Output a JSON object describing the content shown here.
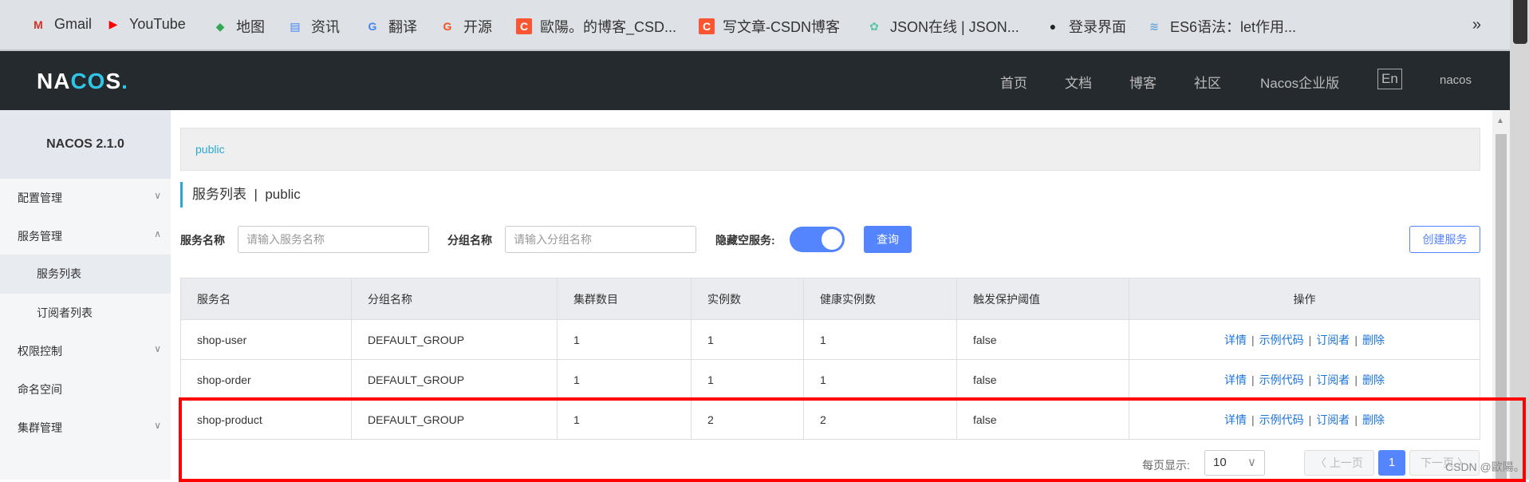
{
  "bookmarks": [
    {
      "label": "Gmail",
      "icon": "gmail-icon",
      "color": "#d93025"
    },
    {
      "label": "YouTube",
      "icon": "youtube-icon",
      "color": "#ff0000"
    },
    {
      "label": "地图",
      "icon": "maps-icon",
      "color": "#34a853"
    },
    {
      "label": "资讯",
      "icon": "news-icon",
      "color": "#4285f4"
    },
    {
      "label": "翻译",
      "icon": "translate-icon",
      "color": "#4285f4"
    },
    {
      "label": "开源",
      "icon": "g-icon",
      "color": "#f4511e"
    },
    {
      "label": "歐陽。的博客_CSD...",
      "icon": "csdn-icon",
      "color": "#fc5531"
    },
    {
      "label": "写文章-CSDN博客",
      "icon": "csdn-icon",
      "color": "#fc5531"
    },
    {
      "label": "JSON在线 | JSON...",
      "icon": "flower-icon",
      "color": "#5cc7a8"
    },
    {
      "label": "登录界面",
      "icon": "globe-icon",
      "color": "#222"
    },
    {
      "label": "ES6语法：let作用...",
      "icon": "scroll-icon",
      "color": "#6aa6d8"
    }
  ],
  "bookmarks_more": "»",
  "header": {
    "logo": "NACOS.",
    "nav": [
      "首页",
      "文档",
      "博客",
      "社区",
      "Nacos企业版"
    ],
    "lang": "En",
    "user": "nacos"
  },
  "sidebar": {
    "version": "NACOS 2.1.0",
    "items": [
      {
        "label": "配置管理",
        "chevron": "down"
      },
      {
        "label": "服务管理",
        "chevron": "up"
      },
      {
        "label": "服务列表",
        "sub": true,
        "selected": true
      },
      {
        "label": "订阅者列表",
        "sub": true
      },
      {
        "label": "权限控制",
        "chevron": "down"
      },
      {
        "label": "命名空间"
      },
      {
        "label": "集群管理",
        "chevron": "down"
      }
    ]
  },
  "breadcrumb": "public",
  "page_title": "服务列表",
  "page_title_sep": "|",
  "page_namespace": "public",
  "filters": {
    "service_name_label": "服务名称",
    "service_name_placeholder": "请输入服务名称",
    "group_name_label": "分组名称",
    "group_name_placeholder": "请输入分组名称",
    "hide_empty_label": "隐藏空服务:",
    "hide_empty_on": true,
    "query_button": "查询",
    "create_button": "创建服务"
  },
  "table": {
    "columns": [
      "服务名",
      "分组名称",
      "集群数目",
      "实例数",
      "健康实例数",
      "触发保护阈值",
      "操作"
    ],
    "rows": [
      [
        "shop-user",
        "DEFAULT_GROUP",
        "1",
        "1",
        "1",
        "false"
      ],
      [
        "shop-order",
        "DEFAULT_GROUP",
        "1",
        "1",
        "1",
        "false"
      ],
      [
        "shop-product",
        "DEFAULT_GROUP",
        "1",
        "2",
        "2",
        "false"
      ]
    ],
    "actions": [
      "详情",
      "示例代码",
      "订阅者",
      "删除"
    ]
  },
  "pagination": {
    "per_page_label": "每页显示:",
    "per_page": "10",
    "prev": "上一页",
    "current": "1",
    "next": "下一页"
  },
  "watermark": "CSDN @歐陽。",
  "accent": "#5584ff",
  "highlight_color": "#ff0000"
}
